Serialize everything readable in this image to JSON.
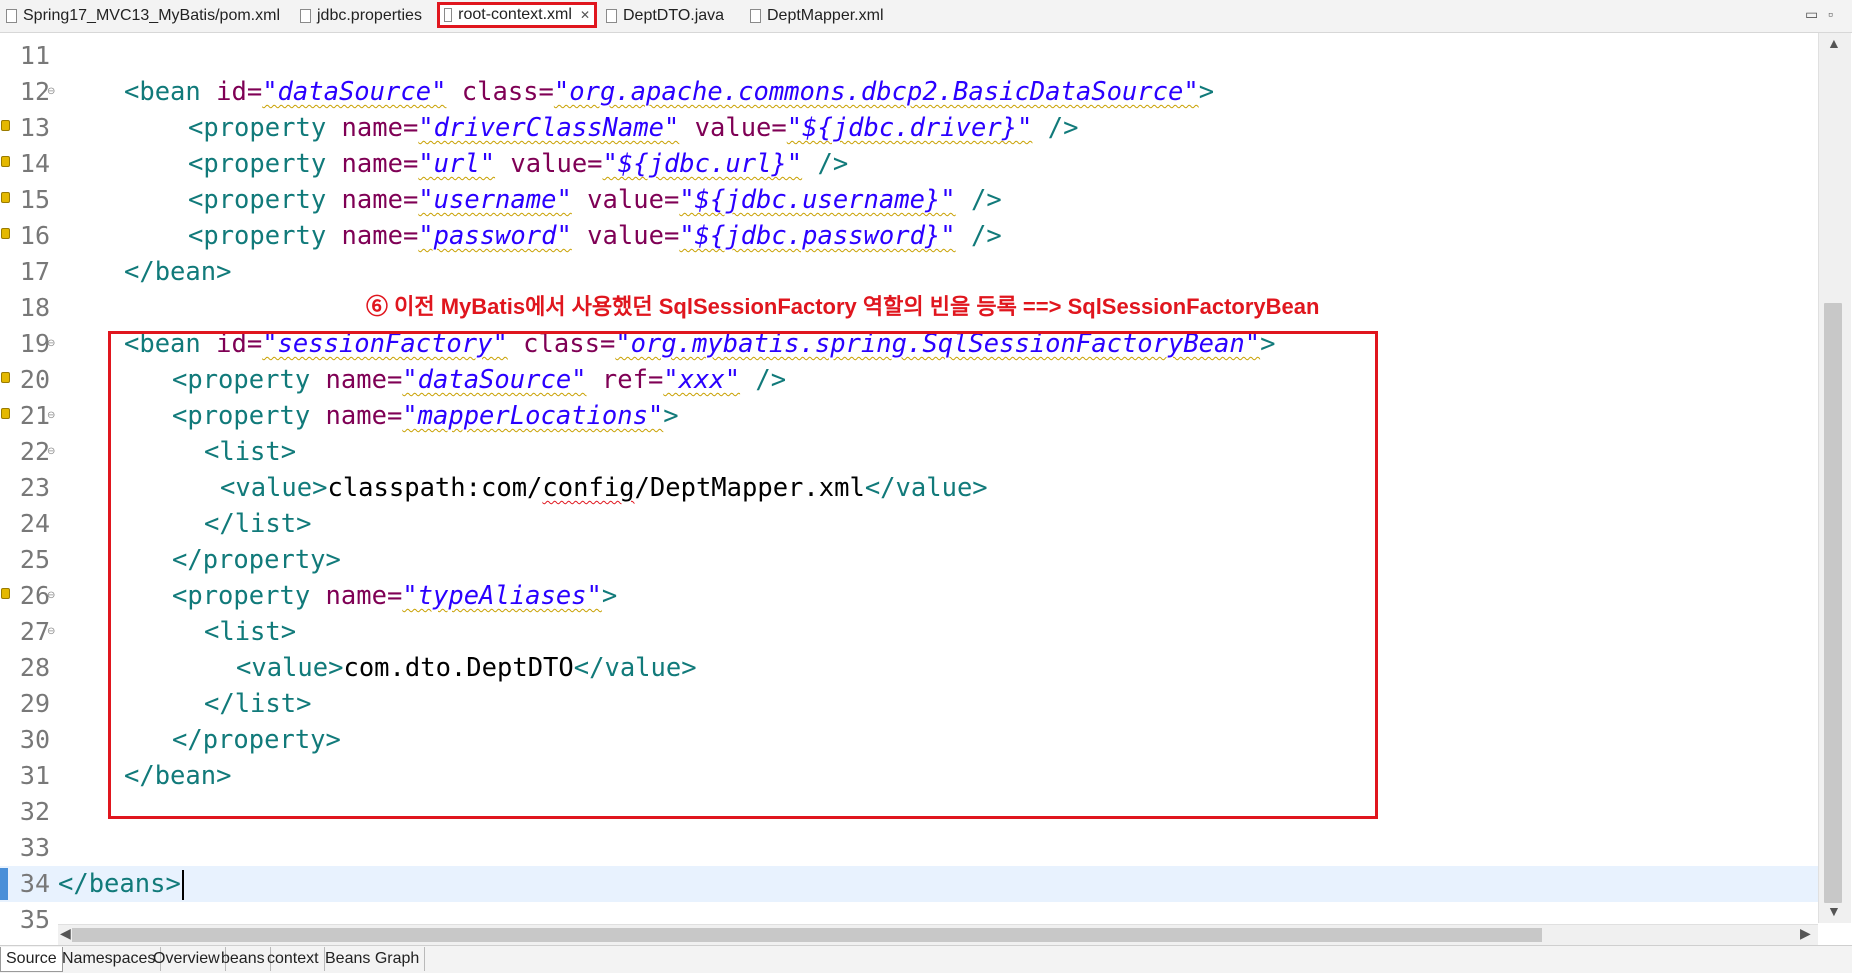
{
  "tabs": [
    {
      "label": "Spring17_MVC13_MyBatis/pom.xml",
      "icon": "xml-file-icon",
      "active": false
    },
    {
      "label": "jdbc.properties",
      "icon": "properties-file-icon",
      "active": false
    },
    {
      "label": "root-context.xml",
      "icon": "xml-file-icon",
      "active": true
    },
    {
      "label": "DeptDTO.java",
      "icon": "java-file-icon",
      "active": false
    },
    {
      "label": "DeptMapper.xml",
      "icon": "xml-file-icon",
      "active": false
    }
  ],
  "window_controls": {
    "minimize": "▭",
    "maximize": "▫"
  },
  "annotation": "⑥ 이전 MyBatis에서 사용했던 SqlSessionFactory 역할의 빈을 등록 ==> SqlSessionFactoryBean",
  "lines": [
    {
      "n": "11"
    },
    {
      "n": "12",
      "fold": true,
      "t": "<bean ",
      "a1": "id=",
      "v1": "\"dataSource\"",
      "a2": " class=",
      "v2": "\"org.apache.commons.dbcp2.BasicDataSource\"",
      "e": ">"
    },
    {
      "n": "13",
      "warn": true,
      "t": "<property ",
      "a1": "name=",
      "v1": "\"driverClassName\"",
      "a2": " value=",
      "v2": "\"${jdbc.driver}\"",
      "e": " />"
    },
    {
      "n": "14",
      "warn": true,
      "t": "<property ",
      "a1": "name=",
      "v1": "\"url\"",
      "a2": " value=",
      "v2": "\"${jdbc.url}\"",
      "e": " />"
    },
    {
      "n": "15",
      "warn": true,
      "t": "<property ",
      "a1": "name=",
      "v1": "\"username\"",
      "a2": " value=",
      "v2": "\"${jdbc.username}\"",
      "e": " />"
    },
    {
      "n": "16",
      "warn": true,
      "t": "<property ",
      "a1": "name=",
      "v1": "\"password\"",
      "a2": " value=",
      "v2": "\"${jdbc.password}\"",
      "e": " />"
    },
    {
      "n": "17",
      "t": "</bean>"
    },
    {
      "n": "18"
    },
    {
      "n": "19",
      "fold": true,
      "t": "<bean ",
      "a1": "id=",
      "v1": "\"sessionFactory\"",
      "a2": " class=",
      "v2": "\"org.mybatis.spring.SqlSessionFactoryBean\"",
      "e": ">"
    },
    {
      "n": "20",
      "warn": true,
      "t": "<property ",
      "a1": "name=",
      "v1": "\"dataSource\"",
      "a2": " ref=",
      "v2": "\"xxx\"",
      "e": " />"
    },
    {
      "n": "21",
      "warn": true,
      "fold": true,
      "t": "<property ",
      "a1": "name=",
      "v1": "\"mapperLocations\"",
      "e": ">"
    },
    {
      "n": "22",
      "fold": true,
      "t": "<list>"
    },
    {
      "n": "23",
      "t": "<value>",
      "x1": "classpath:com/",
      "x2": "config",
      "x3": "/DeptMapper.xml",
      "e": "</value>"
    },
    {
      "n": "24",
      "t": "</list>"
    },
    {
      "n": "25",
      "t": "</property>"
    },
    {
      "n": "26",
      "warn": true,
      "fold": true,
      "t": "<property ",
      "a1": "name=",
      "v1": "\"typeAliases\"",
      "e": ">"
    },
    {
      "n": "27",
      "fold": true,
      "t": "<list>"
    },
    {
      "n": "28",
      "t": "<value>",
      "x1": "com.dto.DeptDTO",
      "e": "</value>"
    },
    {
      "n": "29",
      "t": "</list>"
    },
    {
      "n": "30",
      "t": "</property>"
    },
    {
      "n": "31",
      "t": "</bean>"
    },
    {
      "n": "32"
    },
    {
      "n": "33"
    },
    {
      "n": "34",
      "current": true,
      "t": "</beans>"
    },
    {
      "n": "35"
    }
  ],
  "bottom_tabs": [
    "Source",
    "Namespaces",
    "Overview",
    "beans",
    "context",
    "Beans Graph"
  ],
  "colors": {
    "tag": "#117a7a",
    "attr": "#7f0055",
    "value": "#2a00ff",
    "highlight": "#e0161e"
  }
}
